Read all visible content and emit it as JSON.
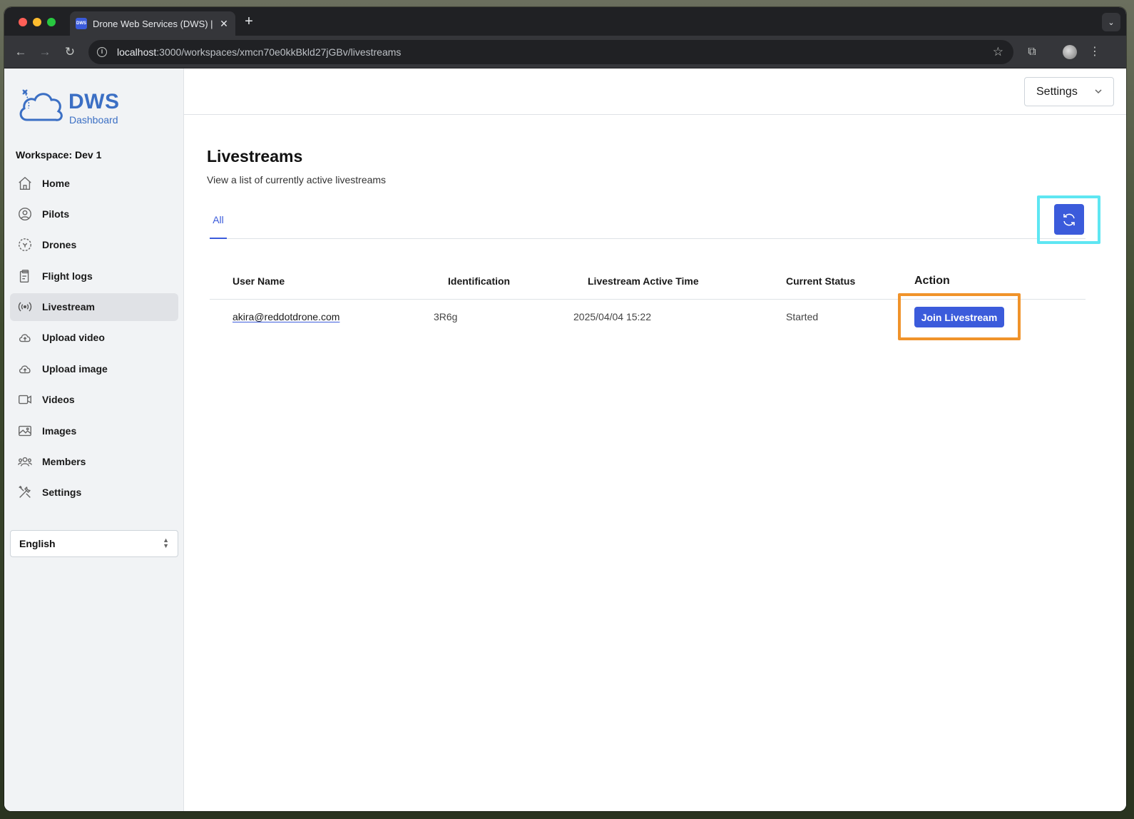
{
  "browser": {
    "tab_title": "Drone Web Services (DWS) | ...",
    "favicon_text": "DWS",
    "url_host": "localhost",
    "url_path": ":3000/workspaces/xmcn70e0kkBkld27jGBv/livestreams"
  },
  "sidebar": {
    "logo_title": "DWS",
    "logo_subtitle": "Dashboard",
    "workspace_label": "Workspace: Dev 1",
    "items": [
      {
        "label": "Home",
        "icon": "home-icon"
      },
      {
        "label": "Pilots",
        "icon": "user-circle-icon"
      },
      {
        "label": "Drones",
        "icon": "drone-icon"
      },
      {
        "label": "Flight logs",
        "icon": "clipboard-icon"
      },
      {
        "label": "Livestream",
        "icon": "broadcast-icon",
        "active": true
      },
      {
        "label": "Upload video",
        "icon": "cloud-upload-icon"
      },
      {
        "label": "Upload image",
        "icon": "cloud-upload-icon"
      },
      {
        "label": "Videos",
        "icon": "video-icon"
      },
      {
        "label": "Images",
        "icon": "image-icon"
      },
      {
        "label": "Members",
        "icon": "users-icon"
      },
      {
        "label": "Settings",
        "icon": "tools-icon"
      }
    ],
    "language": "English"
  },
  "header": {
    "settings_label": "Settings"
  },
  "main": {
    "title": "Livestreams",
    "subtitle": "View a list of currently active livestreams",
    "tabs": [
      {
        "label": "All",
        "active": true
      }
    ],
    "table": {
      "headers": [
        "User Name",
        "Identification",
        "Livestream Active Time",
        "Current Status",
        "Action"
      ],
      "rows": [
        {
          "user": "akira@reddotdrone.com",
          "identification": "3R6g",
          "active_time": "2025/04/04 15:22",
          "status": "Started",
          "action": "Join Livestream"
        }
      ]
    }
  },
  "colors": {
    "accent": "#3b5bdb",
    "refresh_highlight": "#5ee6f2",
    "action_highlight": "#f0932b"
  }
}
